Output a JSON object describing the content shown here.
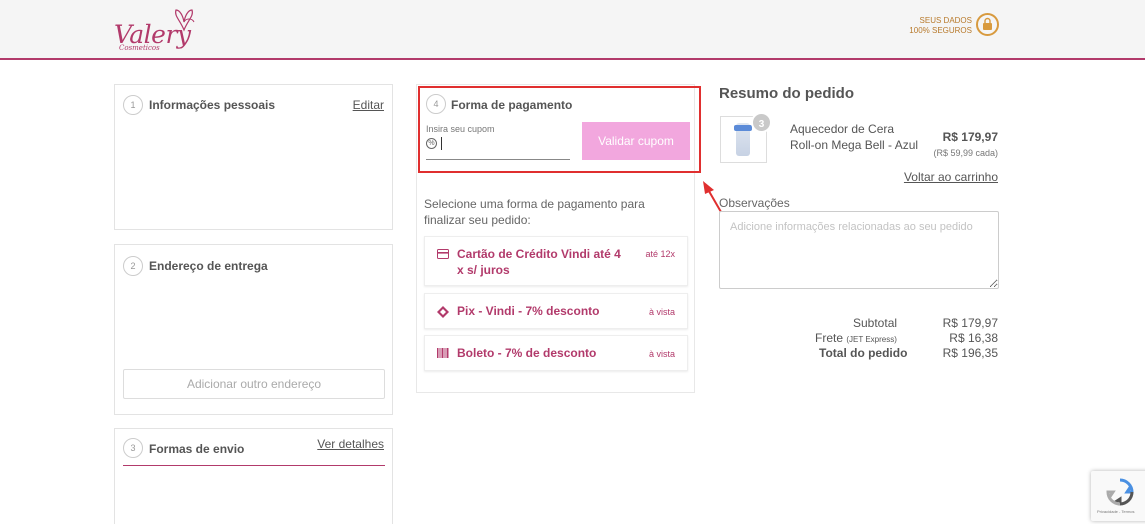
{
  "header": {
    "logo_text": "Valery",
    "logo_sub": "Cosmeticos",
    "secure_line1": "SEUS DADOS",
    "secure_line2": "100% SEGUROS"
  },
  "steps": [
    {
      "number": "1",
      "title": "Informações pessoais",
      "action": "Editar"
    },
    {
      "number": "2",
      "title": "Endereço de entrega",
      "action": "Adicionar outro endereço"
    },
    {
      "number": "3",
      "title": "Formas de envio",
      "action": "Ver detalhes"
    }
  ],
  "payment": {
    "number": "4",
    "title": "Forma de pagamento",
    "coupon_label": "Insira seu cupom",
    "coupon_value": "",
    "validate_button": "Validar cupom",
    "hint": "Selecione uma forma de pagamento para finalizar seu pedido:",
    "options": [
      {
        "label": "Cartão de Crédito Vindi até 4 x s/ juros",
        "meta": "até 12x",
        "icon": "credit-card-icon"
      },
      {
        "label": "Pix - Vindi - 7% desconto",
        "meta": "à vista",
        "icon": "pix-icon"
      },
      {
        "label": "Boleto - 7% de desconto",
        "meta": "à vista",
        "icon": "barcode-icon"
      }
    ]
  },
  "summary": {
    "title": "Resumo do pedido",
    "item": {
      "quantity": "3",
      "name": "Aquecedor de Cera Roll-on Mega Bell - Azul",
      "price": "R$ 179,97",
      "unit_price": "(R$ 59,99 cada)"
    },
    "back_to_cart": "Voltar ao carrinho",
    "notes_label": "Observações",
    "notes_placeholder": "Adicione informações relacionadas ao seu pedido",
    "totals": {
      "subtotal_label": "Subtotal",
      "subtotal_value": "R$ 179,97",
      "shipping_label": "Frete",
      "shipping_carrier": "(JET Express)",
      "shipping_value": "R$ 16,38",
      "total_label": "Total do pedido",
      "total_value": "R$ 196,35"
    }
  },
  "recaptcha": {
    "text": "Privacidade - Termos"
  },
  "colors": {
    "brand": "#b23a6b",
    "button_pink": "#f2a7de",
    "highlight_red": "#e02f2f",
    "secure_gold": "#d89a3e"
  }
}
